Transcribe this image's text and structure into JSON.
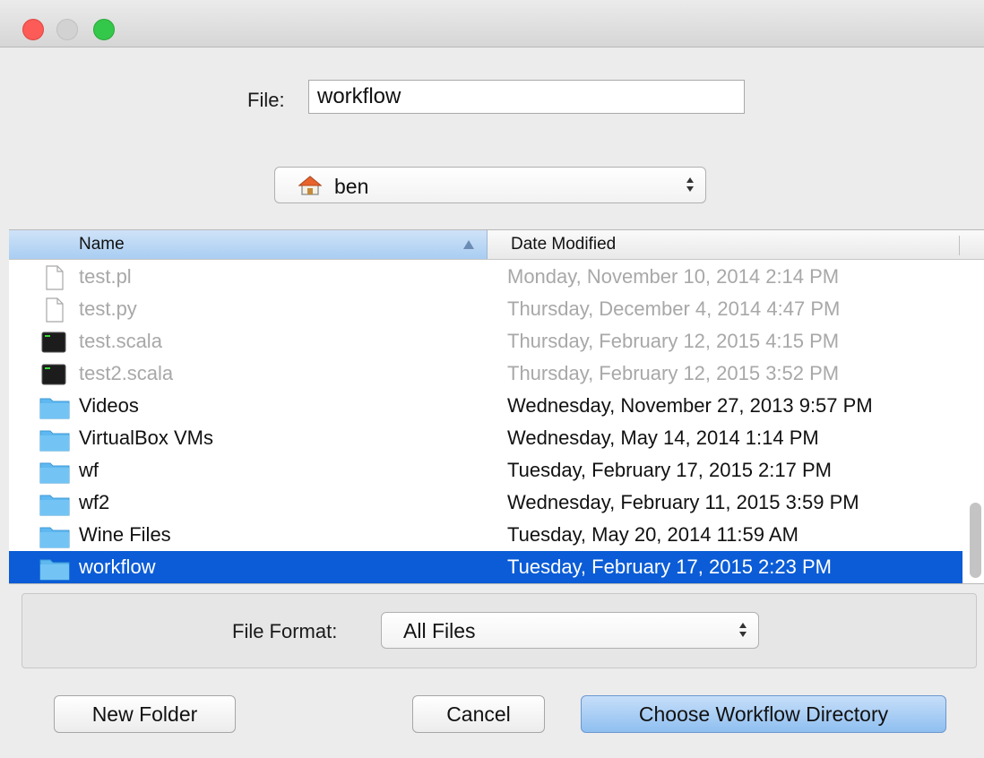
{
  "file_field": {
    "label": "File:",
    "value": "workflow"
  },
  "location": {
    "current": "ben",
    "icon": "home-icon"
  },
  "table": {
    "columns": [
      "Name",
      "Date Modified"
    ],
    "sorted_column": "Name",
    "rows": [
      {
        "name": "test.pl",
        "date": "Monday, November 10, 2014 2:14 PM",
        "type": "document",
        "state": "dim"
      },
      {
        "name": "test.py",
        "date": "Thursday, December 4, 2014 4:47 PM",
        "type": "document",
        "state": "dim"
      },
      {
        "name": "test.scala",
        "date": "Thursday, February 12, 2015 4:15 PM",
        "type": "terminal",
        "state": "dim"
      },
      {
        "name": "test2.scala",
        "date": "Thursday, February 12, 2015 3:52 PM",
        "type": "terminal",
        "state": "dim"
      },
      {
        "name": "Videos",
        "date": "Wednesday, November 27, 2013 9:57 PM",
        "type": "folder",
        "state": "normal"
      },
      {
        "name": "VirtualBox VMs",
        "date": "Wednesday, May 14, 2014 1:14 PM",
        "type": "folder",
        "state": "normal"
      },
      {
        "name": "wf",
        "date": "Tuesday, February 17, 2015 2:17 PM",
        "type": "folder",
        "state": "normal"
      },
      {
        "name": "wf2",
        "date": "Wednesday, February 11, 2015 3:59 PM",
        "type": "folder",
        "state": "normal"
      },
      {
        "name": "Wine Files",
        "date": "Tuesday, May 20, 2014 11:59 AM",
        "type": "folder",
        "state": "normal"
      },
      {
        "name": "workflow",
        "date": "Tuesday, February 17, 2015 2:23 PM",
        "type": "folder",
        "state": "selected"
      }
    ]
  },
  "file_format": {
    "label": "File Format:",
    "value": "All Files"
  },
  "buttons": {
    "new_folder": "New Folder",
    "cancel": "Cancel",
    "choose": "Choose Workflow Directory"
  },
  "colors": {
    "selection": "#0b5cd6",
    "folder": "#5fb8f0",
    "close_light": "#fc5b57",
    "zoom_light": "#34c84a",
    "primary_button": "#8fbff0"
  }
}
